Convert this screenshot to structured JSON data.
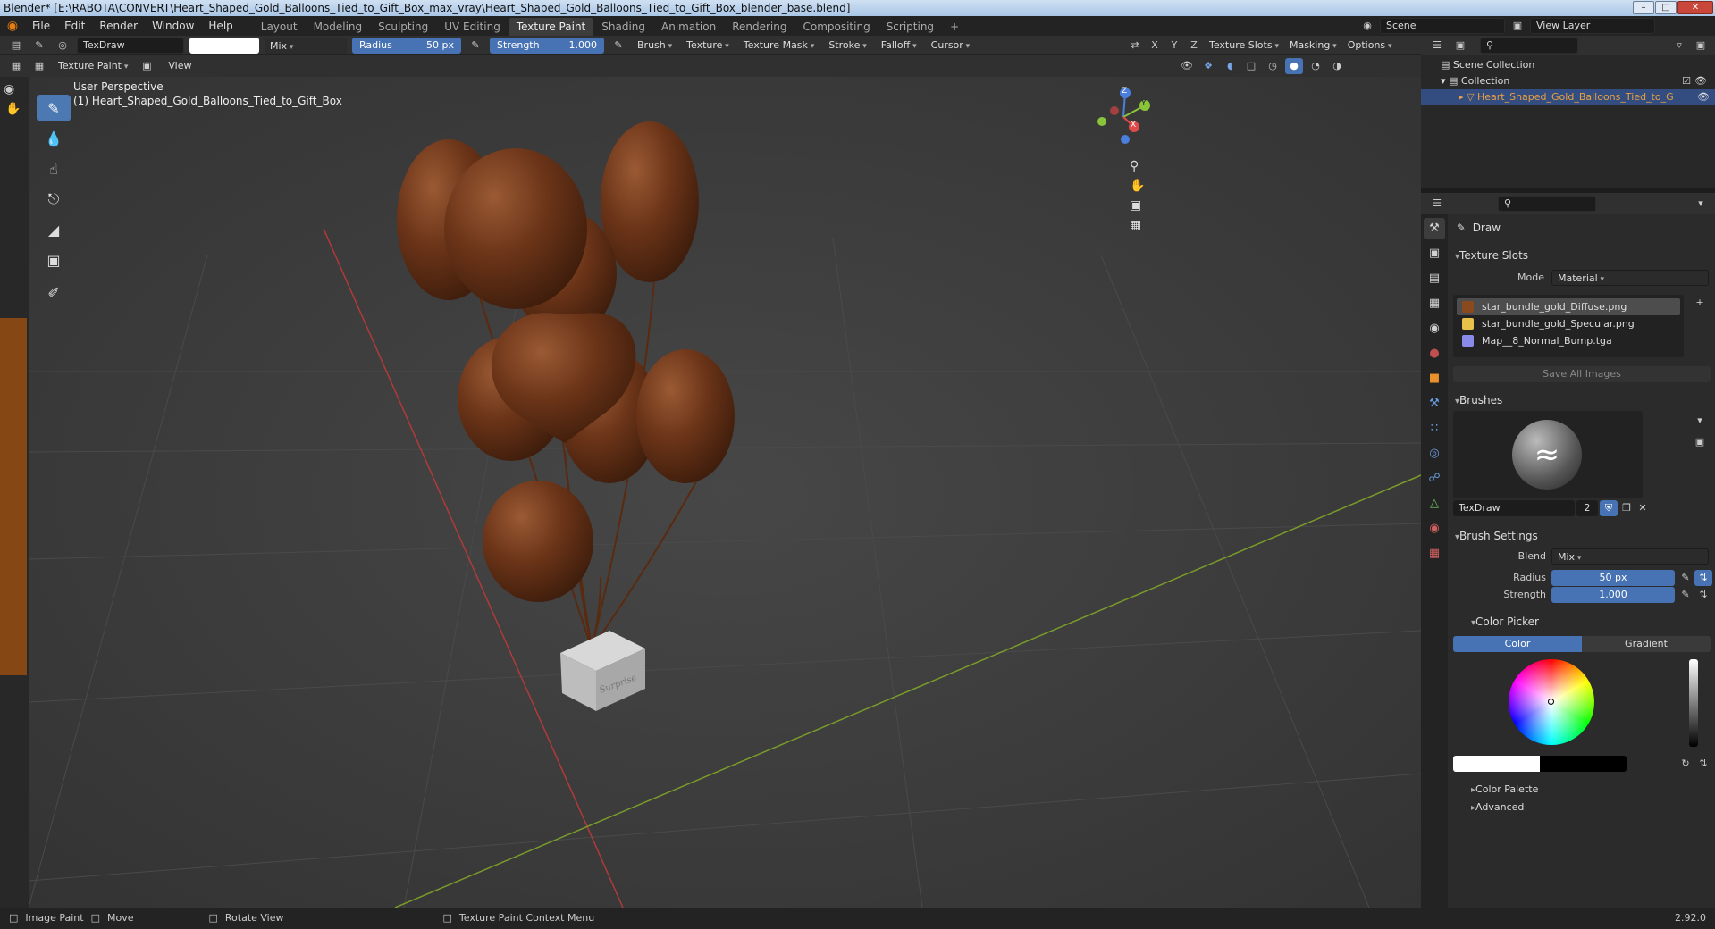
{
  "window": {
    "title": "Blender* [E:\\RABOTA\\CONVERT\\Heart_Shaped_Gold_Balloons_Tied_to_Gift_Box_max_vray\\Heart_Shaped_Gold_Balloons_Tied_to_Gift_Box_blender_base.blend]"
  },
  "menu": [
    "File",
    "Edit",
    "Render",
    "Window",
    "Help"
  ],
  "workspaces": [
    {
      "label": "Layout"
    },
    {
      "label": "Modeling"
    },
    {
      "label": "Sculpting"
    },
    {
      "label": "UV Editing"
    },
    {
      "label": "Texture Paint",
      "active": true
    },
    {
      "label": "Shading"
    },
    {
      "label": "Animation"
    },
    {
      "label": "Rendering"
    },
    {
      "label": "Compositing"
    },
    {
      "label": "Scripting"
    },
    {
      "label": "+"
    }
  ],
  "scene": {
    "label": "Scene",
    "view_layer": "View Layer"
  },
  "tool_header": {
    "brush_name": "TexDraw",
    "blend": "Mix",
    "radius_label": "Radius",
    "radius_value": "50 px",
    "strength_label": "Strength",
    "strength_value": "1.000",
    "menus": [
      "Brush",
      "Texture",
      "Texture Mask",
      "Stroke",
      "Falloff",
      "Cursor"
    ],
    "axes": [
      "X",
      "Y",
      "Z"
    ],
    "right_menus": [
      "Texture Slots",
      "Masking",
      "Options"
    ]
  },
  "viewport_header": {
    "mode": "Texture Paint",
    "view": "View"
  },
  "viewport": {
    "perspective": "User Perspective",
    "object": "(1) Heart_Shaped_Gold_Balloons_Tied_to_Gift_Box",
    "box_text": "Surprise"
  },
  "gizmo": {
    "x": "X",
    "y": "Y",
    "z": "Z"
  },
  "outliner": {
    "scene_collection": "Scene Collection",
    "collection": "Collection",
    "object": "Heart_Shaped_Gold_Balloons_Tied_to_G"
  },
  "properties": {
    "tool_name": "Draw",
    "texture_slots": {
      "title": "Texture Slots",
      "mode_label": "Mode",
      "mode_value": "Material",
      "slots": [
        {
          "name": "star_bundle_gold_Diffuse.png",
          "color": "#8a4a1e"
        },
        {
          "name": "star_bundle_gold_Specular.png",
          "color": "#e8c04a"
        },
        {
          "name": "Map__8_Normal_Bump.tga",
          "color": "#8a8ae8"
        }
      ],
      "save_all": "Save All Images"
    },
    "brushes": {
      "title": "Brushes",
      "name": "TexDraw",
      "users": "2"
    },
    "brush_settings": {
      "title": "Brush Settings",
      "blend_label": "Blend",
      "blend_value": "Mix",
      "radius_label": "Radius",
      "radius_value": "50 px",
      "strength_label": "Strength",
      "strength_value": "1.000"
    },
    "color_picker": {
      "title": "Color Picker",
      "tab_color": "Color",
      "tab_gradient": "Gradient"
    },
    "color_palette": "Color Palette",
    "advanced": "Advanced"
  },
  "status": {
    "image_paint": "Image Paint",
    "move": "Move",
    "rotate": "Rotate View",
    "context": "Texture Paint Context Menu",
    "version": "2.92.0"
  },
  "colors": {
    "accent": "#4772b3",
    "balloon": "#6b3418",
    "grid_x": "#b03a3a",
    "grid_y": "#7a9a2a"
  }
}
